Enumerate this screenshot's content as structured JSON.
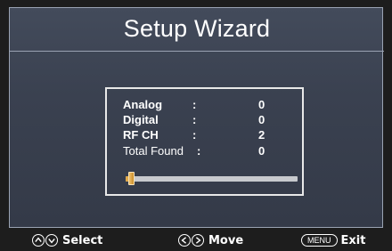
{
  "title": "Setup Wizard",
  "scan": {
    "rows": [
      {
        "label": "Analog",
        "colon": ":",
        "value": "0"
      },
      {
        "label": "Digital",
        "colon": ":",
        "value": "0"
      },
      {
        "label": "RF CH",
        "colon": ":",
        "value": "2"
      },
      {
        "label": "Total Found",
        "colon": ":",
        "value": "0"
      }
    ],
    "progress": 0.03
  },
  "footer": {
    "select_label": "Select",
    "move_label": "Move",
    "menu_key": "MENU",
    "exit_label": "Exit"
  },
  "icons": {
    "up": "up-arrow-icon",
    "down": "down-arrow-icon",
    "left": "left-arrow-icon",
    "right": "right-arrow-icon"
  },
  "colors": {
    "panel": "#3a4150",
    "progress_fill": "#e0a94a",
    "progress_track": "#c7c9cd"
  }
}
